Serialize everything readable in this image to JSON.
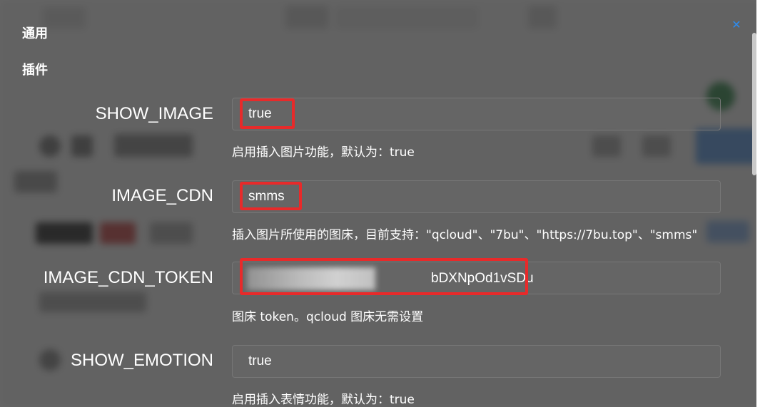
{
  "sections": {
    "general_title": "通用",
    "plugins_title": "插件"
  },
  "settings": [
    {
      "key": "SHOW_IMAGE",
      "value": "true",
      "description": "启用插入图片功能，默认为：true"
    },
    {
      "key": "IMAGE_CDN",
      "value": "smms",
      "description": "插入图片所使用的图床，目前支持：\"qcloud\"、\"7bu\"、\"https://7bu.top\"、\"smms\""
    },
    {
      "key": "IMAGE_CDN_TOKEN",
      "value": "bDXNpOd1vSDu",
      "description": "图床 token。qcloud 图床无需设置"
    },
    {
      "key": "SHOW_EMOTION",
      "value": "true",
      "description": "启用插入表情功能，默认为：true"
    }
  ],
  "close_icon": "close-icon",
  "colors": {
    "highlight": "#e82a2a",
    "close": "#2d8cf0",
    "overlay": "#2a2a2a"
  }
}
